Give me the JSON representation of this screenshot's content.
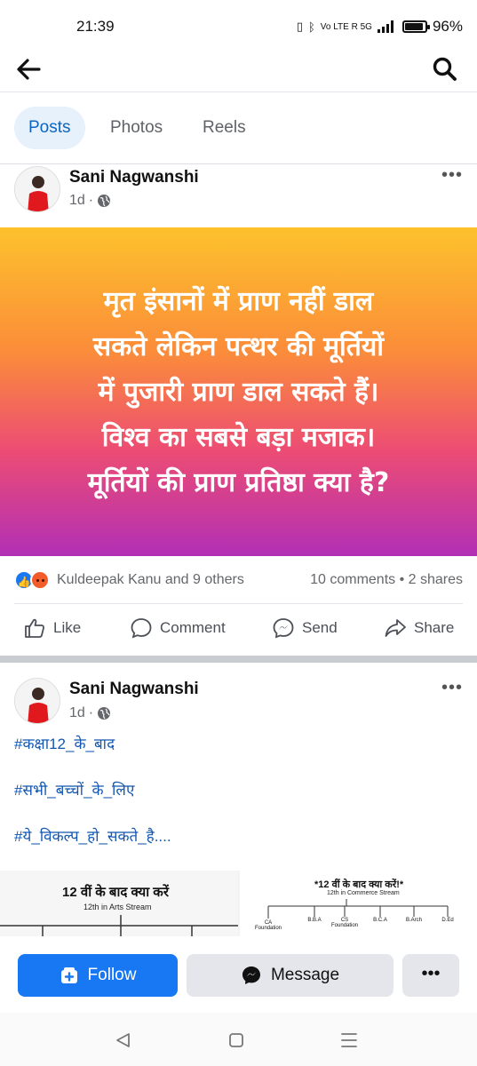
{
  "status_bar": {
    "time": "21:39",
    "network_text": "Vo LTE R 5G",
    "battery": "96%"
  },
  "top_bar": {
    "back_icon": "arrow-left-icon",
    "search_icon": "search-icon"
  },
  "tabs": [
    {
      "label": "Posts",
      "active": true
    },
    {
      "label": "Photos",
      "active": false
    },
    {
      "label": "Reels",
      "active": false
    }
  ],
  "posts": [
    {
      "author": "Sani Nagwanshi",
      "time": "1d",
      "privacy_icon": "globe-icon",
      "more_label": "•••",
      "image_text_lines": [
        "मृत इंसानों में प्राण नहीं डाल",
        "सकते लेकिन पत्थर की मूर्तियों",
        "में पुजारी प्राण डाल सकते हैं।",
        "विश्व का सबसे बड़ा मजाक।",
        "मूर्तियों की प्राण प्रतिष्ठा क्या है?"
      ],
      "reactions_text": "Kuldeepak Kanu and 9 others",
      "comments_shares": "10 comments • 2 shares",
      "actions": {
        "like": "Like",
        "comment": "Comment",
        "send": "Send",
        "share": "Share"
      }
    },
    {
      "author": "Sani Nagwanshi",
      "time": "1d",
      "privacy_icon": "globe-icon",
      "more_label": "•••",
      "hashtags": [
        "#कक्षा12_के_बाद",
        "#सभी_बच्चों_के_लिए",
        "#ये_विकल्प_हो_सकते_है...."
      ],
      "preview": {
        "left_title": "12 वीं के बाद क्या करें",
        "left_sub": "12th in Arts Stream",
        "right_title": "*12 वीं के बाद क्या करें!*",
        "right_sub": "12th in Commerce Stream",
        "right_labels": [
          "CA Foundation",
          "B.B.A",
          "CS Foundation",
          "B.C.A",
          "B.Arch",
          "D.Ed"
        ]
      }
    }
  ],
  "bottom_bar": {
    "follow": "Follow",
    "message": "Message",
    "more": "•••"
  },
  "colors": {
    "accent": "#1877f2",
    "hashtag": "#1457b0",
    "gradient_top": "#fdc22c",
    "gradient_bottom": "#b22fb6"
  }
}
